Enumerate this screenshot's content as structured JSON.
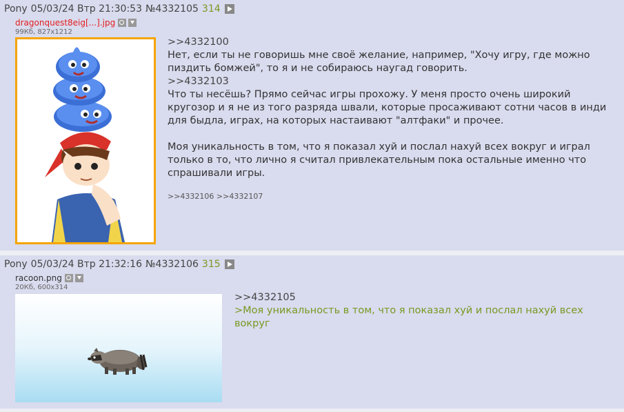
{
  "posts": [
    {
      "header": {
        "name": "Pony",
        "date": "05/03/24 Втр 21:30:53",
        "num": "№4332105",
        "count": "314"
      },
      "file": {
        "name": "dragonquest8eig[...].jpg",
        "meta": "99Кб, 827x1212"
      },
      "message": {
        "reply1": ">>4332100",
        "text1": "Нет, если ты не говоришь мне своё желание, например, \"Хочу игру, где можно пиздить бомжей\", то я и не собираюсь наугад говорить.",
        "reply2": ">>4332103",
        "text2": "Что ты несёшь? Прямо сейчас игры прохожу. У меня просто очень широкий кругозор и я не из того разряда швали, которые просаживают сотни часов в инди для быдла, играх, на которых настаивают \"алтфаки\" и прочее.",
        "text3": "Моя уникальность в том, что я показал хуй и послал нахуй всех вокруг и играл только в то, что лично я считал привлекательным пока остальные именно что спрашивали игры.",
        "replies": ">>4332106 >>4332107"
      }
    },
    {
      "header": {
        "name": "Pony",
        "date": "05/03/24 Втр 21:32:16",
        "num": "№4332106",
        "count": "315"
      },
      "file": {
        "name": "racoon.png",
        "meta": "20Кб, 600x314"
      },
      "message": {
        "reply1": ">>4332105",
        "greentext": ">Моя уникальность в том, что я показал хуй и послал нахуй всех вокруг"
      }
    }
  ],
  "colors": {
    "post_bg": "#d9dbee",
    "page_bg": "#eeeff5",
    "greentext": "#789922",
    "filename_red": "#e31e1e",
    "thumb_border": "#f5a500"
  },
  "icons": [
    "play-icon",
    "search-icon",
    "download-icon"
  ]
}
